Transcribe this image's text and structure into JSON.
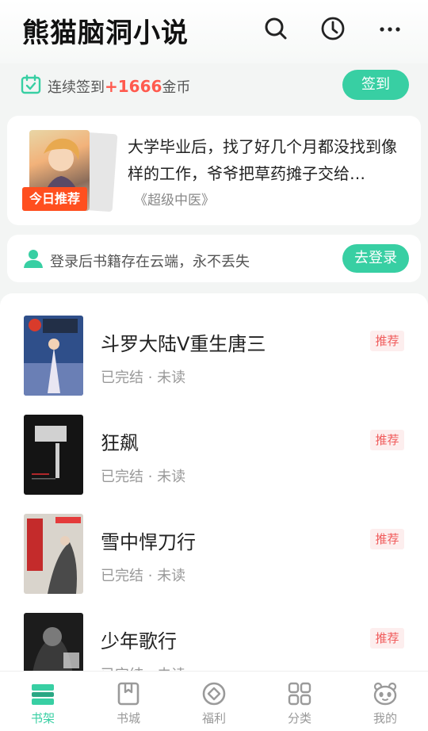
{
  "header": {
    "title": "熊猫脑洞小说",
    "icons": [
      "search-icon",
      "history-icon",
      "more-icon"
    ]
  },
  "signin": {
    "prefix": "连续签到",
    "amount": "+1666",
    "suffix": "金币",
    "button": "签到"
  },
  "recommend": {
    "badge": "今日推荐",
    "description": "大学毕业后，找了好几个月都没找到像样的工作，爷爷把草药摊子交给…",
    "book": "《超级中医》"
  },
  "login": {
    "text": "登录后书籍存在云端，永不丢失",
    "button": "去登录"
  },
  "books": [
    {
      "title": "斗罗大陆V重生唐三",
      "status": "已完结 · 未读",
      "tag": "推荐"
    },
    {
      "title": "狂飙",
      "status": "已完结 · 未读",
      "tag": "推荐"
    },
    {
      "title": "雪中悍刀行",
      "status": "已完结 · 未读",
      "tag": "推荐"
    },
    {
      "title": "少年歌行",
      "status": "已完结 · 未读",
      "tag": "推荐"
    }
  ],
  "tabs": [
    {
      "label": "书架",
      "icon": "bookshelf-icon",
      "active": true
    },
    {
      "label": "书城",
      "icon": "bookstore-icon",
      "active": false
    },
    {
      "label": "福利",
      "icon": "welfare-icon",
      "active": false
    },
    {
      "label": "分类",
      "icon": "category-icon",
      "active": false
    },
    {
      "label": "我的",
      "icon": "panda-profile-icon",
      "active": false
    }
  ],
  "colors": {
    "accent": "#38cfa3",
    "amount": "#ff5a4e",
    "badge": "#ff4f1f",
    "tag_text": "#f05a5a",
    "tag_bg": "#fdeeee"
  }
}
